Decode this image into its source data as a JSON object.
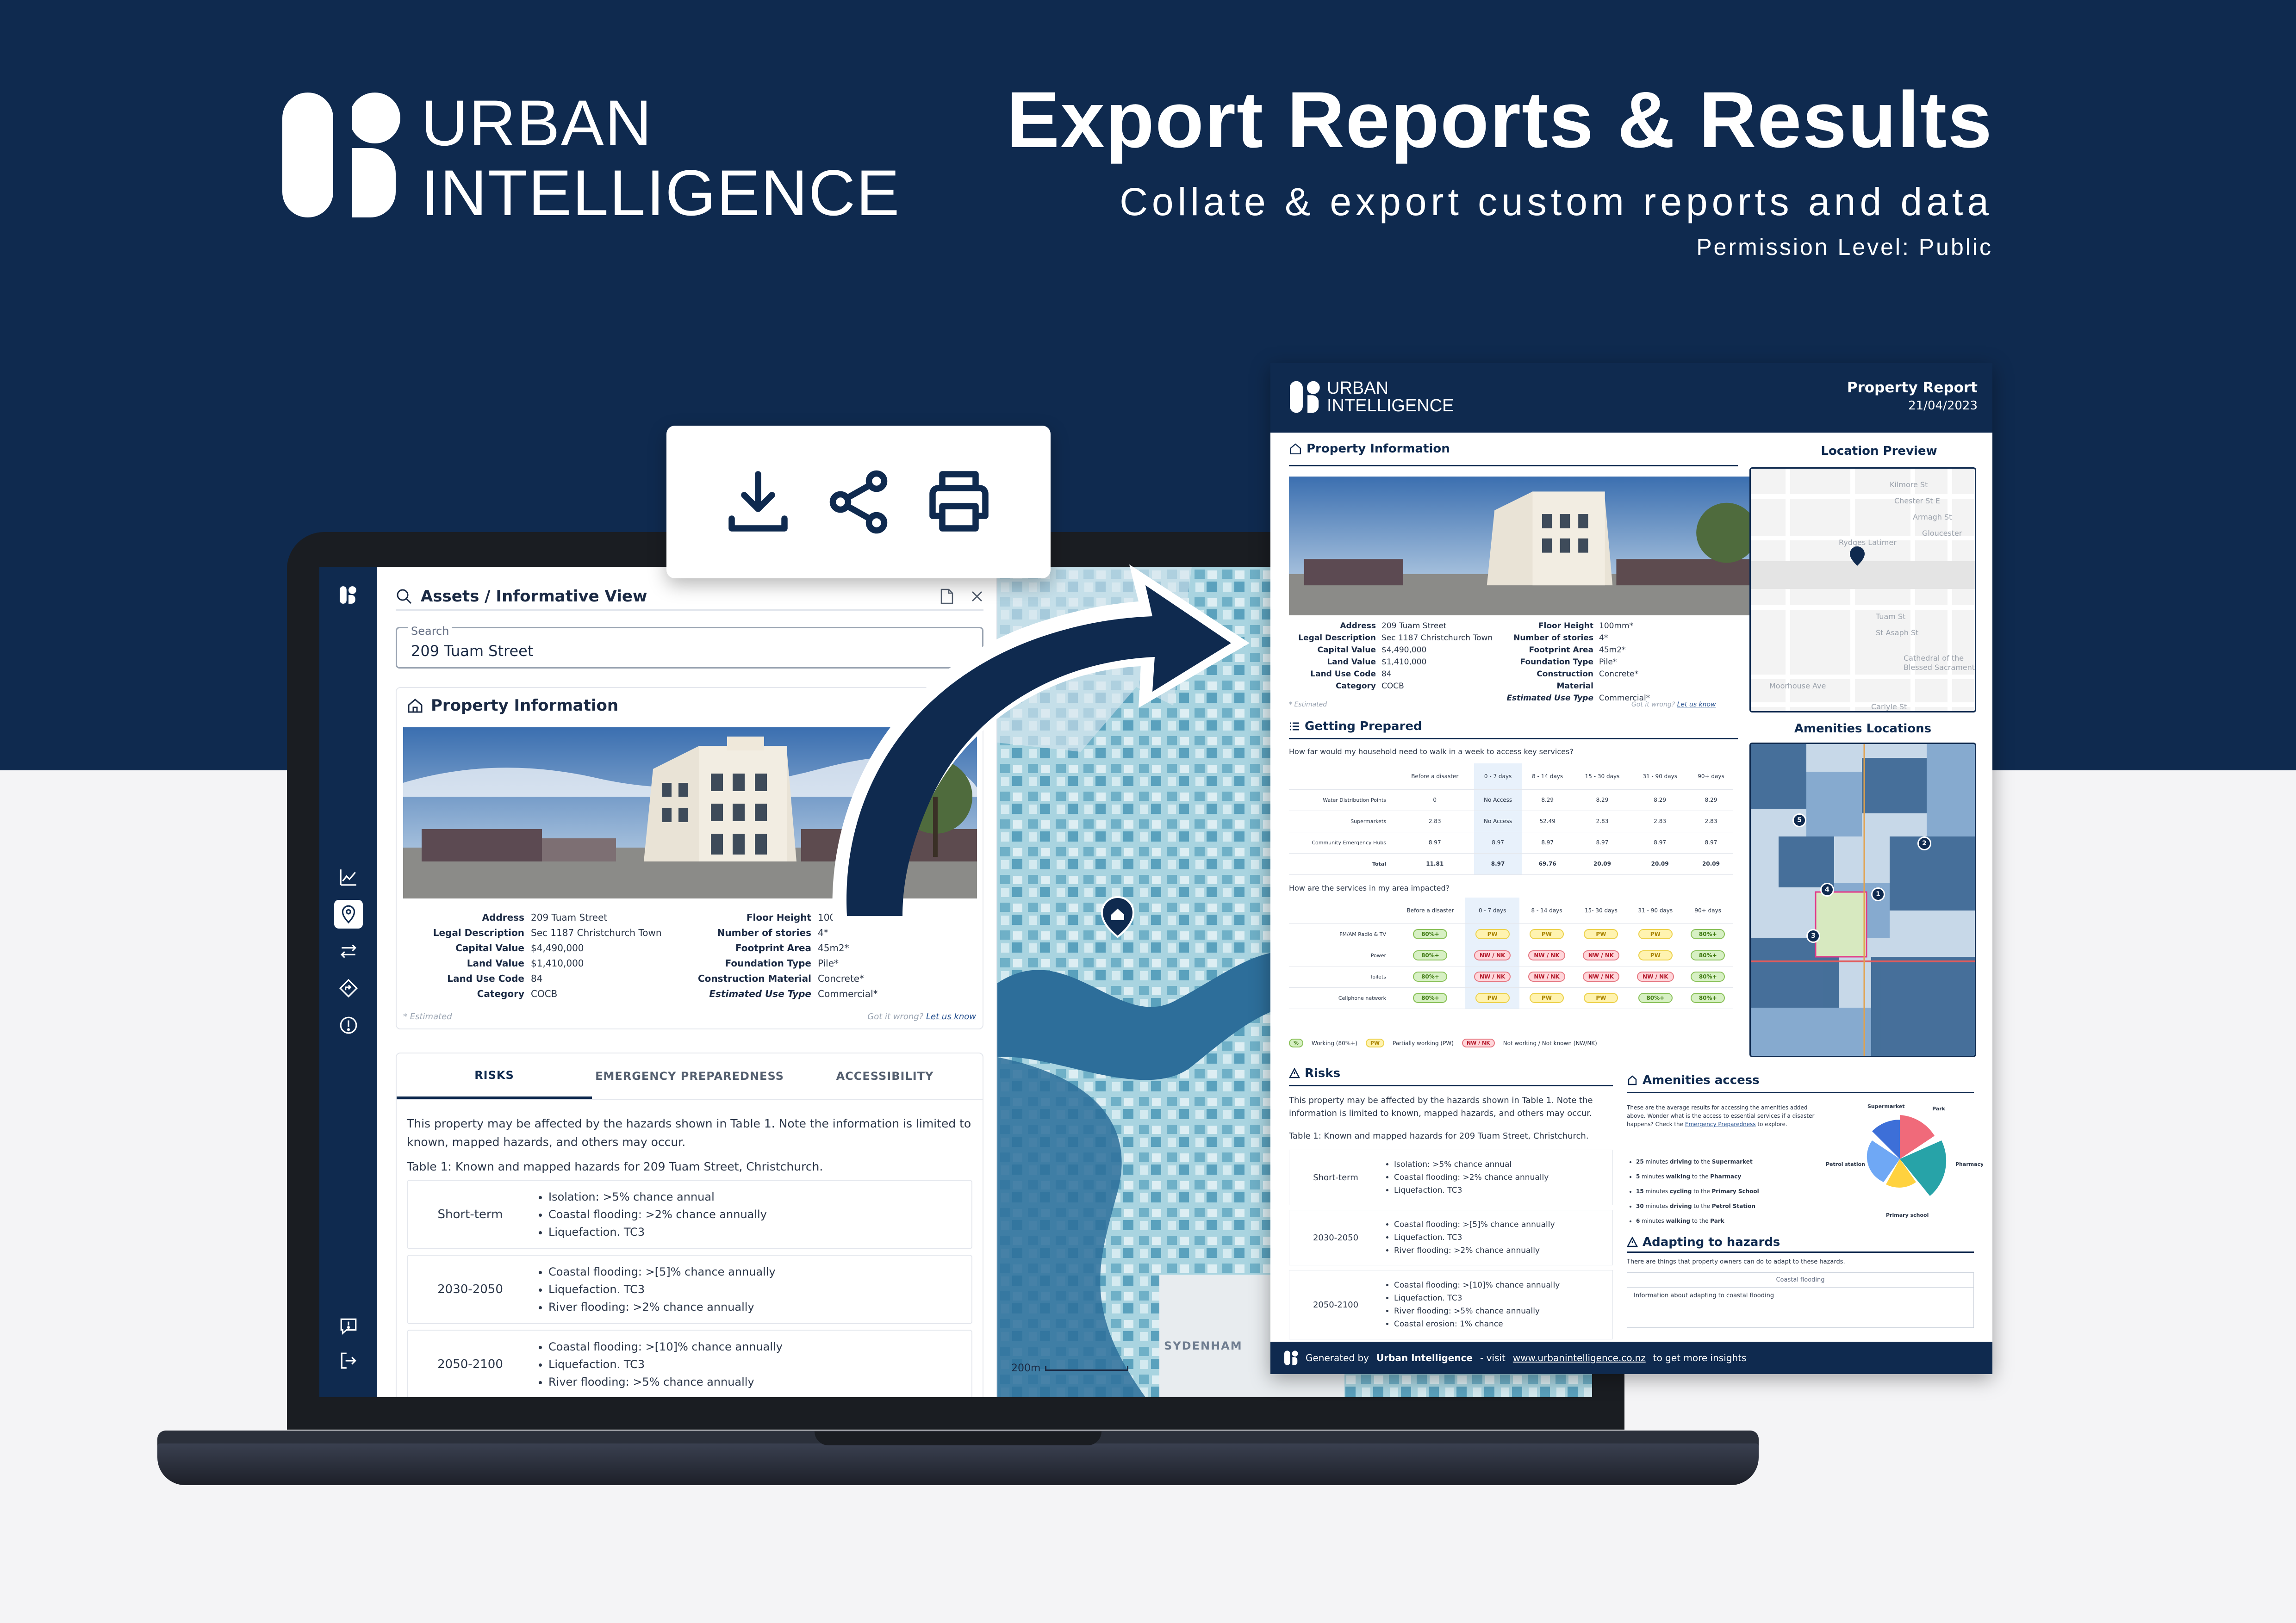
{
  "brand": {
    "line1": "URBAN",
    "line2": "INTELLIGENCE"
  },
  "hero": {
    "headline": "Export Reports & Results",
    "subheadline": "Collate & export custom reports and data",
    "permission": "Permission Level: Public"
  },
  "colors": {
    "navy": "#0f2a4f",
    "map_water": "#2d6e9a",
    "map_light": "#a9d4e0",
    "white": "#ffffff"
  },
  "toolbar": {
    "icons": [
      "download-icon",
      "share-icon",
      "print-icon"
    ]
  },
  "app": {
    "nav_icons": [
      "logo-icon",
      "chart-icon",
      "location-pin-icon",
      "transfer-icon",
      "directions-icon",
      "alert-icon",
      "feedback-icon",
      "logout-icon"
    ],
    "panel_title": "Assets / Informative View",
    "search": {
      "label": "Search",
      "value": "209 Tuam Street"
    },
    "property_title": "Property Information",
    "property_left": [
      {
        "key": "Address",
        "value": "209 Tuam Street"
      },
      {
        "key": "Legal Description",
        "value": "Sec 1187 Christchurch Town"
      },
      {
        "key": "Capital Value",
        "value": "$4,490,000"
      },
      {
        "key": "Land Value",
        "value": "$1,410,000"
      },
      {
        "key": "Land Use Code",
        "value": "84"
      },
      {
        "key": "Category",
        "value": "COCB"
      }
    ],
    "property_right": [
      {
        "key": "Floor Height",
        "value": "100mm*"
      },
      {
        "key": "Number of stories",
        "value": "4*"
      },
      {
        "key": "Footprint Area",
        "value": "45m2*"
      },
      {
        "key": "Foundation Type",
        "value": "Pile*"
      },
      {
        "key": "Construction Material",
        "value": "Concrete*"
      },
      {
        "key": "Estimated Use Type",
        "value": "Commercial*"
      }
    ],
    "estimated_note": "* Estimated",
    "wrong_note": "Got it wrong?",
    "wrong_link": "Let us know",
    "tabs": [
      "RISKS",
      "EMERGENCY PREPAREDNESS",
      "ACCESSIBILITY"
    ],
    "risk_intro": "This property may be affected by the hazards shown in Table 1. Note the information is limited to known, mapped hazards, and others may occur.",
    "risk_caption": "Table 1: Known and mapped hazards for 209 Tuam Street, Christchurch.",
    "risk_rows": [
      {
        "period": "Short-term",
        "items": [
          "Isolation: >5% chance annual",
          "Coastal flooding: >2% chance annually",
          "Liquefaction. TC3"
        ]
      },
      {
        "period": "2030-2050",
        "items": [
          "Coastal flooding: >[5]% chance annually",
          "Liquefaction. TC3",
          "River flooding: >2% chance annually"
        ]
      },
      {
        "period": "2050-2100",
        "items": [
          "Coastal flooding: >[10]% chance annually",
          "Liquefaction. TC3",
          "River flooding: >5% chance annually"
        ]
      }
    ],
    "map_scale": "200m",
    "map_label": "SYDENHAM"
  },
  "report": {
    "logo_line1": "URBAN",
    "logo_line2": "INTELLIGENCE",
    "title": "Property Report",
    "date": "21/04/2023",
    "property_title": "Property Information",
    "property_left": [
      {
        "key": "Address",
        "value": "209 Tuam Street"
      },
      {
        "key": "Legal Description",
        "value": "Sec 1187 Christchurch Town"
      },
      {
        "key": "Capital Value",
        "value": "$4,490,000"
      },
      {
        "key": "Land Value",
        "value": "$1,410,000"
      },
      {
        "key": "Land Use Code",
        "value": "84"
      },
      {
        "key": "Category",
        "value": "COCB"
      }
    ],
    "property_right": [
      {
        "key": "Floor Height",
        "value": "100mm*"
      },
      {
        "key": "Number of stories",
        "value": "4*"
      },
      {
        "key": "Footprint Area",
        "value": "45m2*"
      },
      {
        "key": "Foundation Type",
        "value": "Pile*"
      },
      {
        "key": "Construction Material",
        "value": "Concrete*"
      },
      {
        "key": "Estimated Use Type",
        "value": "Commercial*"
      }
    ],
    "estimated_note": "* Estimated",
    "wrong_note": "Got it wrong?",
    "wrong_link": "Let us know",
    "location_title": "Location  Preview",
    "location_streets": [
      "Kilmore St",
      "Chester St E",
      "Armagh St",
      "Gloucester",
      "Rydges Latimer",
      "Tuam St",
      "St Asaph St",
      "Cathedral of the",
      "Blessed Sacrament",
      "Moorhouse Ave",
      "Carlyle St"
    ],
    "amenities_title": "Amenities Locations",
    "getting_prepared_title": "Getting Prepared",
    "gp_question_1": "How far would my household need to walk in a week to access key services?",
    "gp_columns": [
      "Before a disaster",
      "0 - 7 days",
      "8 - 14 days",
      "15 - 30 days",
      "31 - 90 days",
      "90+ days"
    ],
    "gp_rows": [
      {
        "label": "Water Distribution Points",
        "values": [
          "0",
          "No Access",
          "8.29",
          "8.29",
          "8.29",
          "8.29"
        ]
      },
      {
        "label": "Supermarkets",
        "values": [
          "2.83",
          "No Access",
          "52.49",
          "2.83",
          "2.83",
          "2.83"
        ]
      },
      {
        "label": "Community Emergency Hubs",
        "values": [
          "8.97",
          "8.97",
          "8.97",
          "8.97",
          "8.97",
          "8.97"
        ]
      },
      {
        "label": "Total",
        "values": [
          "11.81",
          "8.97",
          "69.76",
          "20.09",
          "20.09",
          "20.09"
        ]
      }
    ],
    "gp_question_2": "How are the services in my area impacted?",
    "svc_columns": [
      "Before a disaster",
      "0 - 7 days",
      "8 - 14 days",
      "15- 30 days",
      "31 - 90 days",
      "90+ days"
    ],
    "svc_rows": [
      {
        "label": "FM/AM Radio & TV",
        "values": [
          "80%+",
          "PW",
          "PW",
          "PW",
          "PW",
          "80%+"
        ]
      },
      {
        "label": "Power",
        "values": [
          "80%+",
          "NW / NK",
          "NW / NK",
          "NW / NK",
          "PW",
          "80%+"
        ]
      },
      {
        "label": "Toilets",
        "values": [
          "80%+",
          "NW / NK",
          "NW / NK",
          "NW / NK",
          "NW / NK",
          "80%+"
        ]
      },
      {
        "label": "Cellphone network",
        "values": [
          "80%+",
          "PW",
          "PW",
          "PW",
          "80%+",
          "80%+"
        ]
      }
    ],
    "legend": [
      {
        "pill": "%",
        "text": "Working (80%+)"
      },
      {
        "pill": "PW",
        "text": "Partially working (PW)"
      },
      {
        "pill": "NW / NK",
        "text": "Not working / Not known (NW/NK)"
      }
    ],
    "risks_title": "Risks",
    "risks_intro": "This property may be affected by the hazards shown in Table 1. Note the information is limited to known, mapped hazards, and others may occur.",
    "risks_caption": "Table 1: Known and mapped hazards for 209 Tuam Street, Christchurch.",
    "risk_rows": [
      {
        "period": "Short-term",
        "items": [
          "Isolation: >5% chance annual",
          "Coastal flooding: >2% chance annually",
          "Liquefaction. TC3"
        ]
      },
      {
        "period": "2030-2050",
        "items": [
          "Coastal flooding: >[5]% chance annually",
          "Liquefaction. TC3",
          "River flooding: >2% chance annually"
        ]
      },
      {
        "period": "2050-2100",
        "items": [
          "Coastal flooding: >[10]% chance annually",
          "Liquefaction. TC3",
          "River flooding: >5% chance annually",
          "Coastal erosion: 1% chance"
        ]
      }
    ],
    "amenities_access_title": "Amenities access",
    "amenities_access_text": "These are the average results for accessing the amenities added above. Wonder what is the access to essential services if a disaster happens? Check the",
    "amenities_access_link": "Emergency Preparedness",
    "amenities_access_tail": "to explore.",
    "amenities_list": [
      {
        "minutes": "25",
        "mode": "driving",
        "place": "Supermarket"
      },
      {
        "minutes": "5",
        "mode": "walking",
        "place": "Pharmacy"
      },
      {
        "minutes": "15",
        "mode": "cycling",
        "place": "Primary School"
      },
      {
        "minutes": "30",
        "mode": "driving",
        "place": "Petrol Station"
      },
      {
        "minutes": "6",
        "mode": "walking",
        "place": "Park"
      }
    ],
    "amenities_chart_labels": [
      "Supermarket",
      "Park",
      "Petrol station",
      "Pharmacy",
      "Primary school"
    ],
    "adapting_title": "Adapting to hazards",
    "adapting_text": "There are things that property owners can do to adapt to these hazards.",
    "adapting_box_title": "Coastal flooding",
    "adapting_box_body": "Information about adapting to coastal flooding",
    "footer_prefix": "Generated by",
    "footer_brand": "Urban Intelligence",
    "footer_mid": "- visit",
    "footer_url": "www.urbanintelligence.co.nz",
    "footer_tail": "to get more insights"
  },
  "amenity_markers": [
    "1",
    "3",
    "4",
    "5",
    "2"
  ]
}
